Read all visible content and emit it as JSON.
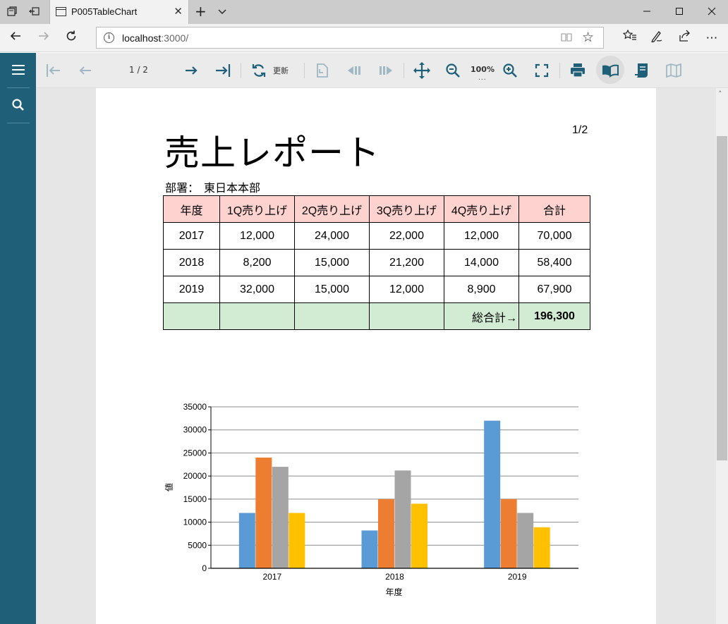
{
  "browser": {
    "tab_title": "P005TableChart",
    "url_host": "localhost",
    "url_rest": ":3000/"
  },
  "viewer": {
    "page_indicator": "1 / 2",
    "refresh_label": "更新",
    "zoom_label": "100%",
    "zoom_dots": "..."
  },
  "report": {
    "title": "売上レポート",
    "page_number": "1/2",
    "department_label": "部署：",
    "department_value": "東日本本部",
    "table": {
      "headers": [
        "年度",
        "1Q売り上げ",
        "2Q売り上げ",
        "3Q売り上げ",
        "4Q売り上げ",
        "合計"
      ],
      "rows": [
        [
          "2017",
          "12,000",
          "24,000",
          "22,000",
          "12,000",
          "70,000"
        ],
        [
          "2018",
          "8,200",
          "15,000",
          "21,200",
          "14,000",
          "58,400"
        ],
        [
          "2019",
          "32,000",
          "15,000",
          "12,000",
          "8,900",
          "67,900"
        ]
      ],
      "total_label": "総合計→",
      "grand_total": "196,300"
    }
  },
  "chart_data": {
    "type": "bar",
    "categories": [
      "2017",
      "2018",
      "2019"
    ],
    "series": [
      {
        "values": [
          12000,
          8200,
          32000
        ],
        "color": "#5b9bd5"
      },
      {
        "values": [
          24000,
          15000,
          15000
        ],
        "color": "#ed7d31"
      },
      {
        "values": [
          22000,
          21200,
          12000
        ],
        "color": "#a5a5a5"
      },
      {
        "values": [
          12000,
          14000,
          8900
        ],
        "color": "#ffc000"
      }
    ],
    "xlabel": "年度",
    "ylabel": "値",
    "ylim": [
      0,
      35000
    ],
    "yticks": [
      0,
      5000,
      10000,
      15000,
      20000,
      25000,
      30000,
      35000
    ],
    "grid": true,
    "legend": "none"
  }
}
